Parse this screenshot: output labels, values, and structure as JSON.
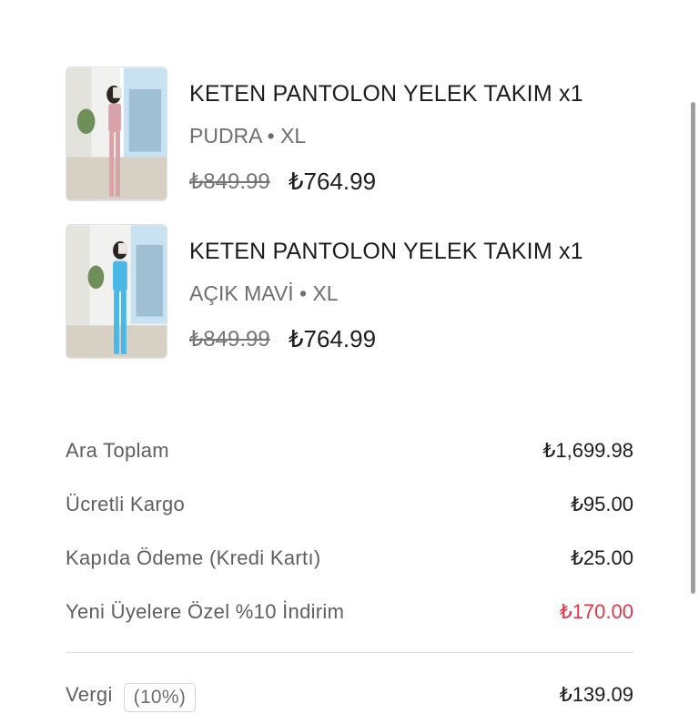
{
  "cart": {
    "items": [
      {
        "title": "KETEN PANTOLON YELEK TAKIM",
        "quantity": "x1",
        "variant": "PUDRA • XL",
        "old_price": "₺849.99",
        "new_price": "₺764.99",
        "image_icon": "product-photo-pink-suit",
        "outfit_color": "#d9a1a8"
      },
      {
        "title": "KETEN PANTOLON YELEK TAKIM",
        "quantity": "x1",
        "variant": "AÇIK MAVİ • XL",
        "old_price": "₺849.99",
        "new_price": "₺764.99",
        "image_icon": "product-photo-blue-suit",
        "outfit_color": "#4ab8e6"
      }
    ]
  },
  "summary": {
    "subtotal": {
      "label": "Ara Toplam",
      "value": "₺1,699.98"
    },
    "shipping": {
      "label": "Ücretli Kargo",
      "value": "₺95.00"
    },
    "cod": {
      "label": "Kapıda Ödeme (Kredi Kartı)",
      "value": "₺25.00"
    },
    "discount": {
      "label": "Yeni Üyelere Özel %10 İndirim",
      "value": "₺170.00",
      "color": "#e3364a"
    },
    "tax": {
      "label": "Vergi",
      "badge": "(10%)",
      "value": "₺139.09"
    }
  }
}
